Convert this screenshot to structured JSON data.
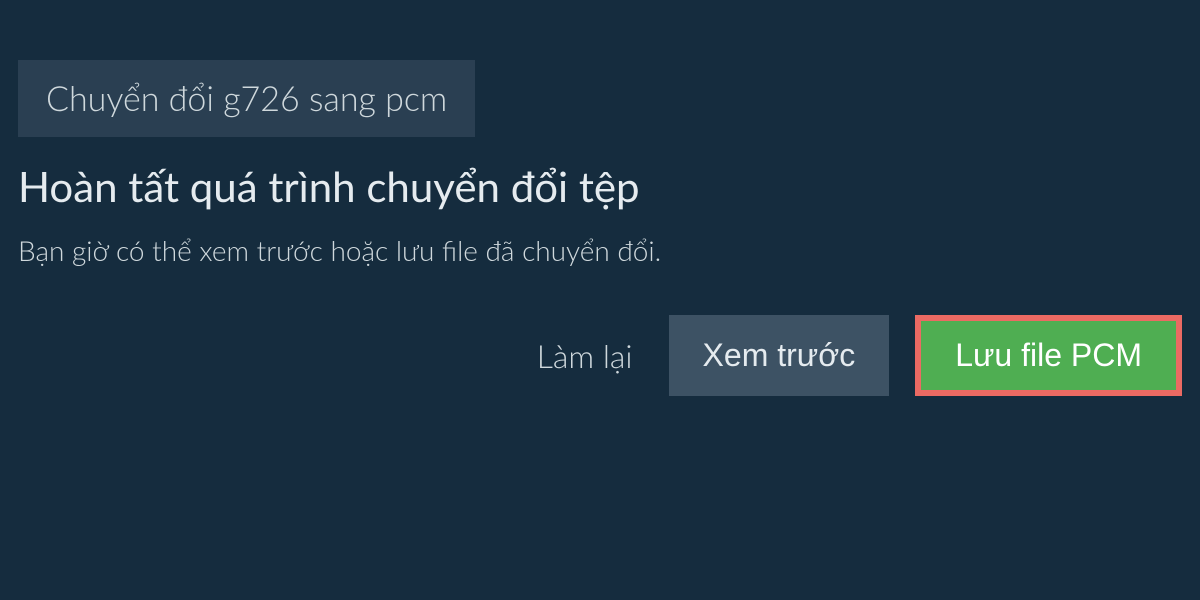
{
  "tab": {
    "label": "Chuyển đổi g726 sang pcm"
  },
  "content": {
    "heading": "Hoàn tất quá trình chuyển đổi tệp",
    "description": "Bạn giờ có thể xem trước hoặc lưu file đã chuyển đổi."
  },
  "actions": {
    "redo_label": "Làm lại",
    "preview_label": "Xem trước",
    "save_label": "Lưu file PCM"
  }
}
